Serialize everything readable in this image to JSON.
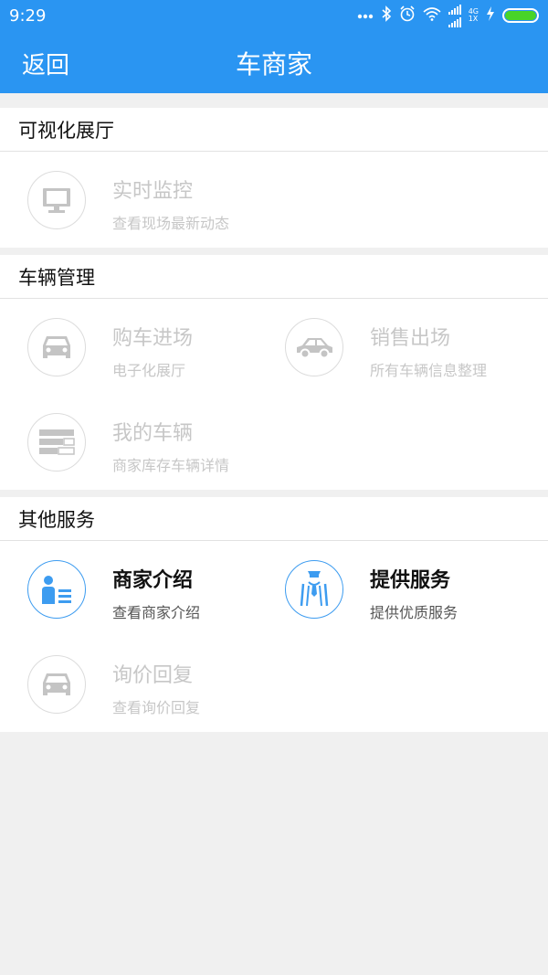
{
  "status_bar": {
    "time": "9:29",
    "net_top": "4G",
    "net_bottom": "1X"
  },
  "header": {
    "back_label": "返回",
    "title": "车商家"
  },
  "colors": {
    "header_bg": "#2a95f2",
    "active_icon": "#3d9cf0",
    "inactive_icon": "#c4c4c4",
    "battery": "#48d428"
  },
  "sections": [
    {
      "title": "可视化展厅",
      "items": [
        {
          "title": "实时监控",
          "subtitle": "查看现场最新动态",
          "icon": "monitor-icon",
          "enabled": false
        }
      ]
    },
    {
      "title": "车辆管理",
      "items": [
        {
          "title": "购车进场",
          "subtitle": "电子化展厅",
          "icon": "car-front-icon",
          "enabled": false
        },
        {
          "title": "销售出场",
          "subtitle": "所有车辆信息整理",
          "icon": "car-side-icon",
          "enabled": false
        },
        {
          "title": "我的车辆",
          "subtitle": "商家库存车辆详情",
          "icon": "list-icon",
          "enabled": false
        }
      ]
    },
    {
      "title": "其他服务",
      "items": [
        {
          "title": "商家介绍",
          "subtitle": "查看商家介绍",
          "icon": "id-card-icon",
          "enabled": true
        },
        {
          "title": "提供服务",
          "subtitle": "提供优质服务",
          "icon": "service-staff-icon",
          "enabled": true
        },
        {
          "title": "询价回复",
          "subtitle": "查看询价回复",
          "icon": "car-front-icon",
          "enabled": false
        }
      ]
    }
  ]
}
